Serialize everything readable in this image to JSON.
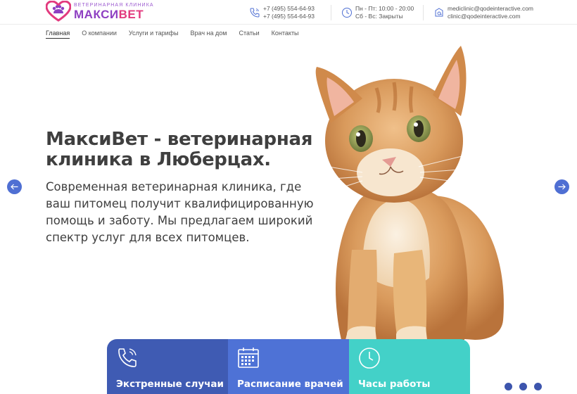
{
  "logo": {
    "subtitle": "ВЕТЕРИНАРНАЯ КЛИНИКА",
    "name_part1": "МАКСИ",
    "name_part2": "ВЕТ"
  },
  "contacts": {
    "phones": [
      "+7 (495) 554-64-93",
      "+7 (495) 554-64-93"
    ],
    "hours": [
      "Пн - Пт: 10:00 - 20:00",
      "Сб - Вс: Закрыты"
    ],
    "emails": [
      "mediclinic@qodeinteractive.com",
      "clinic@qodeinteractive.com"
    ]
  },
  "nav": {
    "items": [
      "Главная",
      "О компании",
      "Услуги и тарифы",
      "Врач на дом",
      "Статьи",
      "Контакты"
    ],
    "active_index": 0
  },
  "hero": {
    "title": "МаксиВет - ветеринарная клиника в Люберцах.",
    "subtitle": "Современная ветеринарная клиника, где ваш питомец получит квалифицированную помощь и заботу. Мы предлагаем широкий спектр услуг для всех питомцев."
  },
  "cards": [
    {
      "title": "Экстренные случаи",
      "icon": "phone-icon",
      "color": "#3f5bb3"
    },
    {
      "title": "Расписание врачей",
      "icon": "calendar-icon",
      "color": "#4e72d6"
    },
    {
      "title": "Часы работы",
      "icon": "clock-icon",
      "color": "#43d1c8"
    }
  ],
  "slider": {
    "dots_count": 3
  },
  "colors": {
    "accent_blue": "#4f6fd3",
    "brand_purple": "#8e3fc2",
    "brand_pink": "#e23a7e",
    "teal": "#43d1c8"
  }
}
